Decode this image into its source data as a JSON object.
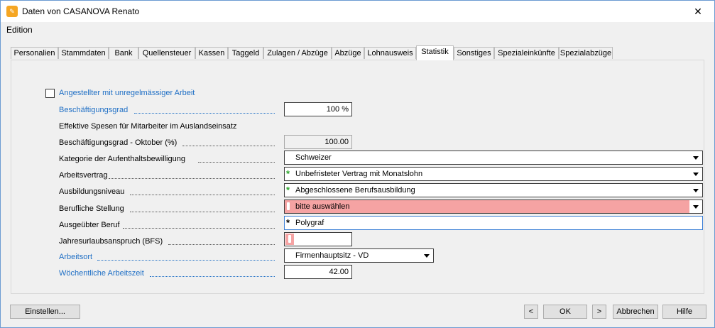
{
  "window": {
    "title": "Daten von CASANOVA Renato",
    "close_glyph": "✕"
  },
  "menu": {
    "edition": "Edition"
  },
  "tabs": [
    "Personalien",
    "Stammdaten",
    "Bank",
    "Quellensteuer",
    "Kassen",
    "Taggeld",
    "Zulagen / Abzüge",
    "Abzüge",
    "Lohnausweis",
    "Statistik",
    "Sonstiges",
    "Spezialeinkünfte",
    "Spezialabzüge"
  ],
  "active_tab": "Statistik",
  "form": {
    "irregular_work_label": "Angestellter mit unregelmässiger Arbeit",
    "irregular_work_checked": false,
    "employment_rate_label": "Beschäftigungsgrad",
    "employment_rate_value": "100 %",
    "expenses_heading": "Effektive Spesen für Mitarbeiter im Auslandseinsatz",
    "employment_rate_october_label": "Beschäftigungsgrad - Oktober (%)",
    "employment_rate_october_value": "100.00",
    "residence_permit_label": "Kategorie der Aufenthaltsbewilligung",
    "residence_permit_value": "Schweizer",
    "contract_label": "Arbeitsvertrag",
    "contract_value": "Unbefristeter Vertrag mit Monatslohn",
    "education_label": "Ausbildungsniveau",
    "education_value": "Abgeschlossene Berufsausbildung",
    "position_label": "Berufliche Stellung",
    "position_value": "bitte auswählen",
    "occupation_label": "Ausgeübter Beruf",
    "occupation_value": "Polygraf",
    "vacation_label": "Jahresurlaubsanspruch  (BFS)",
    "vacation_value": "",
    "workplace_label": "Arbeitsort",
    "workplace_value": "Firmenhauptsitz - VD",
    "weekly_hours_label": "Wöchentliche Arbeitszeit",
    "weekly_hours_value": "42.00"
  },
  "buttons": {
    "settings": "Einstellen...",
    "prev": "<",
    "ok": "OK",
    "next": ">",
    "cancel": "Abbrechen",
    "help": "Hilfe"
  },
  "icons": {
    "star": "*",
    "required_color": "#2aa52a",
    "error_color": "#f5a3a3",
    "link_color": "#1f6fc5"
  }
}
